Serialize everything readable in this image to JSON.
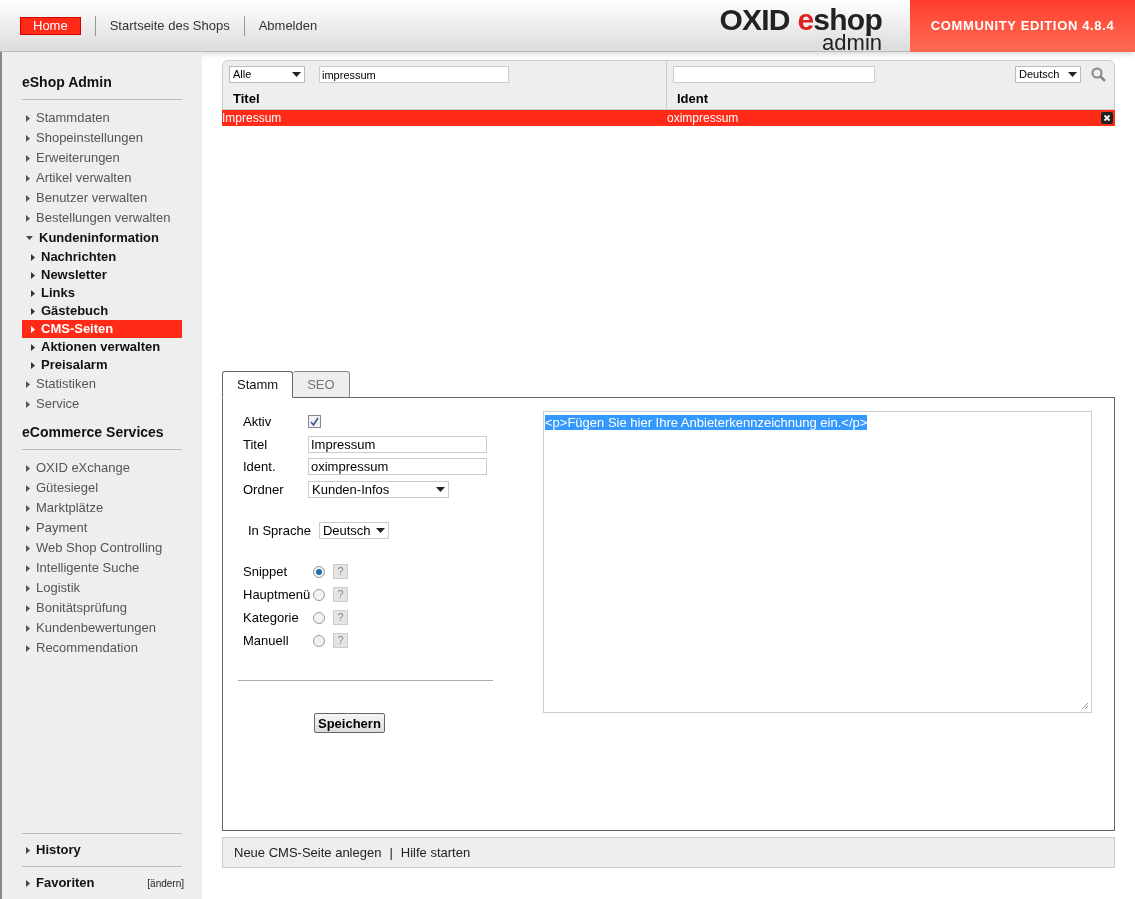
{
  "top_nav": [
    {
      "label": "Home",
      "selected": true
    },
    {
      "label": "Startseite des Shops",
      "selected": false
    },
    {
      "label": "Abmelden",
      "selected": false
    }
  ],
  "logo": {
    "word_1": "OXID",
    "word_2_accent": "e",
    "word_2_rest": "shop",
    "subtitle": "admin"
  },
  "edition": "COMMUNITY EDITION 4.8.4",
  "sidebar": {
    "sections": [
      {
        "title": "eShop Admin",
        "items": [
          {
            "label": "Stammdaten",
            "expanded": false
          },
          {
            "label": "Shopeinstellungen",
            "expanded": false
          },
          {
            "label": "Erweiterungen",
            "expanded": false
          },
          {
            "label": "Artikel verwalten",
            "expanded": false
          },
          {
            "label": "Benutzer verwalten",
            "expanded": false
          },
          {
            "label": "Bestellungen verwalten",
            "expanded": false
          },
          {
            "label": "Kundeninformation",
            "expanded": true,
            "children": [
              {
                "label": "Nachrichten",
                "selected": false
              },
              {
                "label": "Newsletter",
                "selected": false
              },
              {
                "label": "Links",
                "selected": false
              },
              {
                "label": "Gästebuch",
                "selected": false
              },
              {
                "label": "CMS-Seiten",
                "selected": true
              },
              {
                "label": "Aktionen verwalten",
                "selected": false
              },
              {
                "label": "Preisalarm",
                "selected": false
              }
            ]
          },
          {
            "label": "Statistiken",
            "expanded": false
          },
          {
            "label": "Service",
            "expanded": false
          }
        ]
      },
      {
        "title": "eCommerce Services",
        "items": [
          {
            "label": "OXID eXchange",
            "expanded": false
          },
          {
            "label": "Gütesiegel",
            "expanded": false
          },
          {
            "label": "Marktplätze",
            "expanded": false
          },
          {
            "label": "Payment",
            "expanded": false
          },
          {
            "label": "Web Shop Controlling",
            "expanded": false
          },
          {
            "label": "Intelligente Suche",
            "expanded": false
          },
          {
            "label": "Logistik",
            "expanded": false
          },
          {
            "label": "Bonitätsprüfung",
            "expanded": false
          },
          {
            "label": "Kundenbewertungen",
            "expanded": false
          },
          {
            "label": "Recommendation",
            "expanded": false
          }
        ]
      }
    ],
    "history": "History",
    "favorites": "Favoriten",
    "favorites_edit": "[ändern]"
  },
  "list": {
    "type_filter": "Alle",
    "title_filter": "impressum",
    "language": "Deutsch",
    "columns": [
      "Titel",
      "Ident"
    ],
    "rows": [
      {
        "cells": [
          "Impressum",
          "oximpressum"
        ],
        "selected": true
      }
    ]
  },
  "tabs": [
    {
      "label": "Stamm",
      "selected": true
    },
    {
      "label": "SEO",
      "selected": false
    }
  ],
  "form": {
    "active_label": "Aktiv",
    "active_checked": true,
    "title_label": "Titel",
    "title_value": "Impressum",
    "ident_label": "Ident.",
    "ident_value": "oximpressum",
    "folder_label": "Ordner",
    "folder_value": "Kunden-Infos",
    "language_label": "In Sprache",
    "language_value": "Deutsch",
    "load_options": [
      {
        "label": "Snippet",
        "selected": true,
        "help": "?"
      },
      {
        "label": "Hauptmenü",
        "selected": false,
        "help": "?"
      },
      {
        "label": "Kategorie",
        "selected": false,
        "help": "?"
      },
      {
        "label": "Manuell",
        "selected": false,
        "help": "?"
      }
    ],
    "save": "Speichern",
    "editor_text": "<p>Fügen Sie hier Ihre Anbieterkennzeichnung ein.</p>",
    "editor_text_selected": true
  },
  "bottom_links": [
    "Neue CMS-Seite anlegen",
    "Hilfe starten"
  ],
  "bottom_separator": "|"
}
